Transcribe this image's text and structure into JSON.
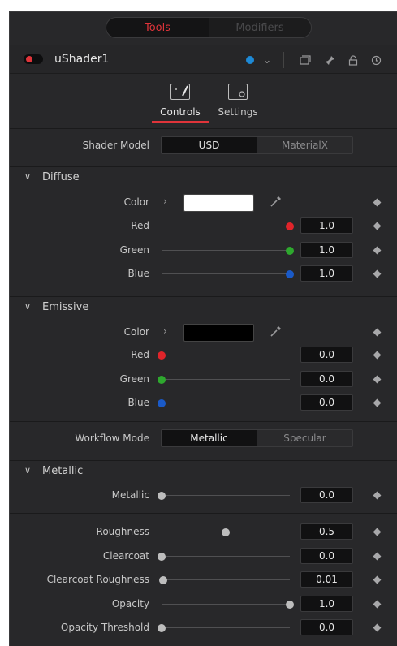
{
  "tabs": {
    "tools": "Tools",
    "modifiers": "Modifiers"
  },
  "node": {
    "name": "uShader1"
  },
  "page_tabs": {
    "controls": "Controls",
    "settings": "Settings"
  },
  "shader_model": {
    "label": "Shader Model",
    "options": [
      "USD",
      "MaterialX"
    ],
    "selected": "USD"
  },
  "diffuse": {
    "title": "Diffuse",
    "color_label": "Color",
    "swatch_color": "#ffffff",
    "channels": [
      {
        "label": "Red",
        "value": "1.0",
        "fraction": 1.0,
        "dot_color": "#e0242a"
      },
      {
        "label": "Green",
        "value": "1.0",
        "fraction": 1.0,
        "dot_color": "#2ea82e"
      },
      {
        "label": "Blue",
        "value": "1.0",
        "fraction": 1.0,
        "dot_color": "#1a5ac8"
      }
    ]
  },
  "emissive": {
    "title": "Emissive",
    "color_label": "Color",
    "swatch_color": "#000000",
    "channels": [
      {
        "label": "Red",
        "value": "0.0",
        "fraction": 0.0,
        "dot_color": "#e0242a"
      },
      {
        "label": "Green",
        "value": "0.0",
        "fraction": 0.0,
        "dot_color": "#2ea82e"
      },
      {
        "label": "Blue",
        "value": "0.0",
        "fraction": 0.0,
        "dot_color": "#1a5ac8"
      }
    ]
  },
  "workflow_mode": {
    "label": "Workflow Mode",
    "options": [
      "Metallic",
      "Specular"
    ],
    "selected": "Metallic"
  },
  "metallic_section": {
    "title": "Metallic",
    "row": {
      "label": "Metallic",
      "value": "0.0",
      "fraction": 0.0
    }
  },
  "params": [
    {
      "label": "Roughness",
      "value": "0.5",
      "fraction": 0.5
    },
    {
      "label": "Clearcoat",
      "value": "0.0",
      "fraction": 0.0
    },
    {
      "label": "Clearcoat Roughness",
      "value": "0.01",
      "fraction": 0.01
    },
    {
      "label": "Opacity",
      "value": "1.0",
      "fraction": 1.0
    },
    {
      "label": "Opacity Threshold",
      "value": "0.0",
      "fraction": 0.0
    }
  ],
  "colors": {
    "accent": "#e0343a",
    "node_color": "#1e8ad6"
  }
}
